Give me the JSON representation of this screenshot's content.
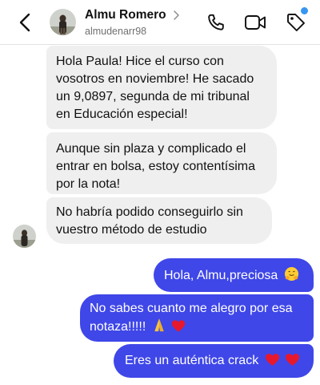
{
  "header": {
    "name": "Almu Romero",
    "username": "almudenarr98",
    "icons": {
      "back": "chevron-left-icon",
      "chevron": "chevron-right-icon",
      "call": "phone-icon",
      "video": "video-camera-icon",
      "tag": "tag-icon"
    },
    "notification_color": "#3797f0"
  },
  "colors": {
    "incoming_bubble": "#efefef",
    "outgoing_bubble": "#3f47e8"
  },
  "messages": [
    {
      "sender": "contact",
      "text": "Hola Paula! Hice el curso con vosotros en noviembre! He sacado un 9,0897, segunda de mi tribunal en Educación especial!"
    },
    {
      "sender": "contact",
      "text": "Aunque sin plaza y complicado el entrar en bolsa, estoy contentísima por la nota!"
    },
    {
      "sender": "contact",
      "text": "No habría podido conseguirlo sin vuestro método de estudio"
    },
    {
      "sender": "me",
      "text": "Hola, Almu,preciosa",
      "emoji": [
        "hugging-face-emoji"
      ]
    },
    {
      "sender": "me",
      "text": "No sabes cuanto me alegro por esa notaza!!!!!",
      "emoji": [
        "folded-hands-emoji",
        "red-heart-emoji"
      ]
    },
    {
      "sender": "me",
      "text": "Eres un auténtica crack",
      "emoji": [
        "red-heart-emoji",
        "red-heart-emoji"
      ]
    }
  ]
}
